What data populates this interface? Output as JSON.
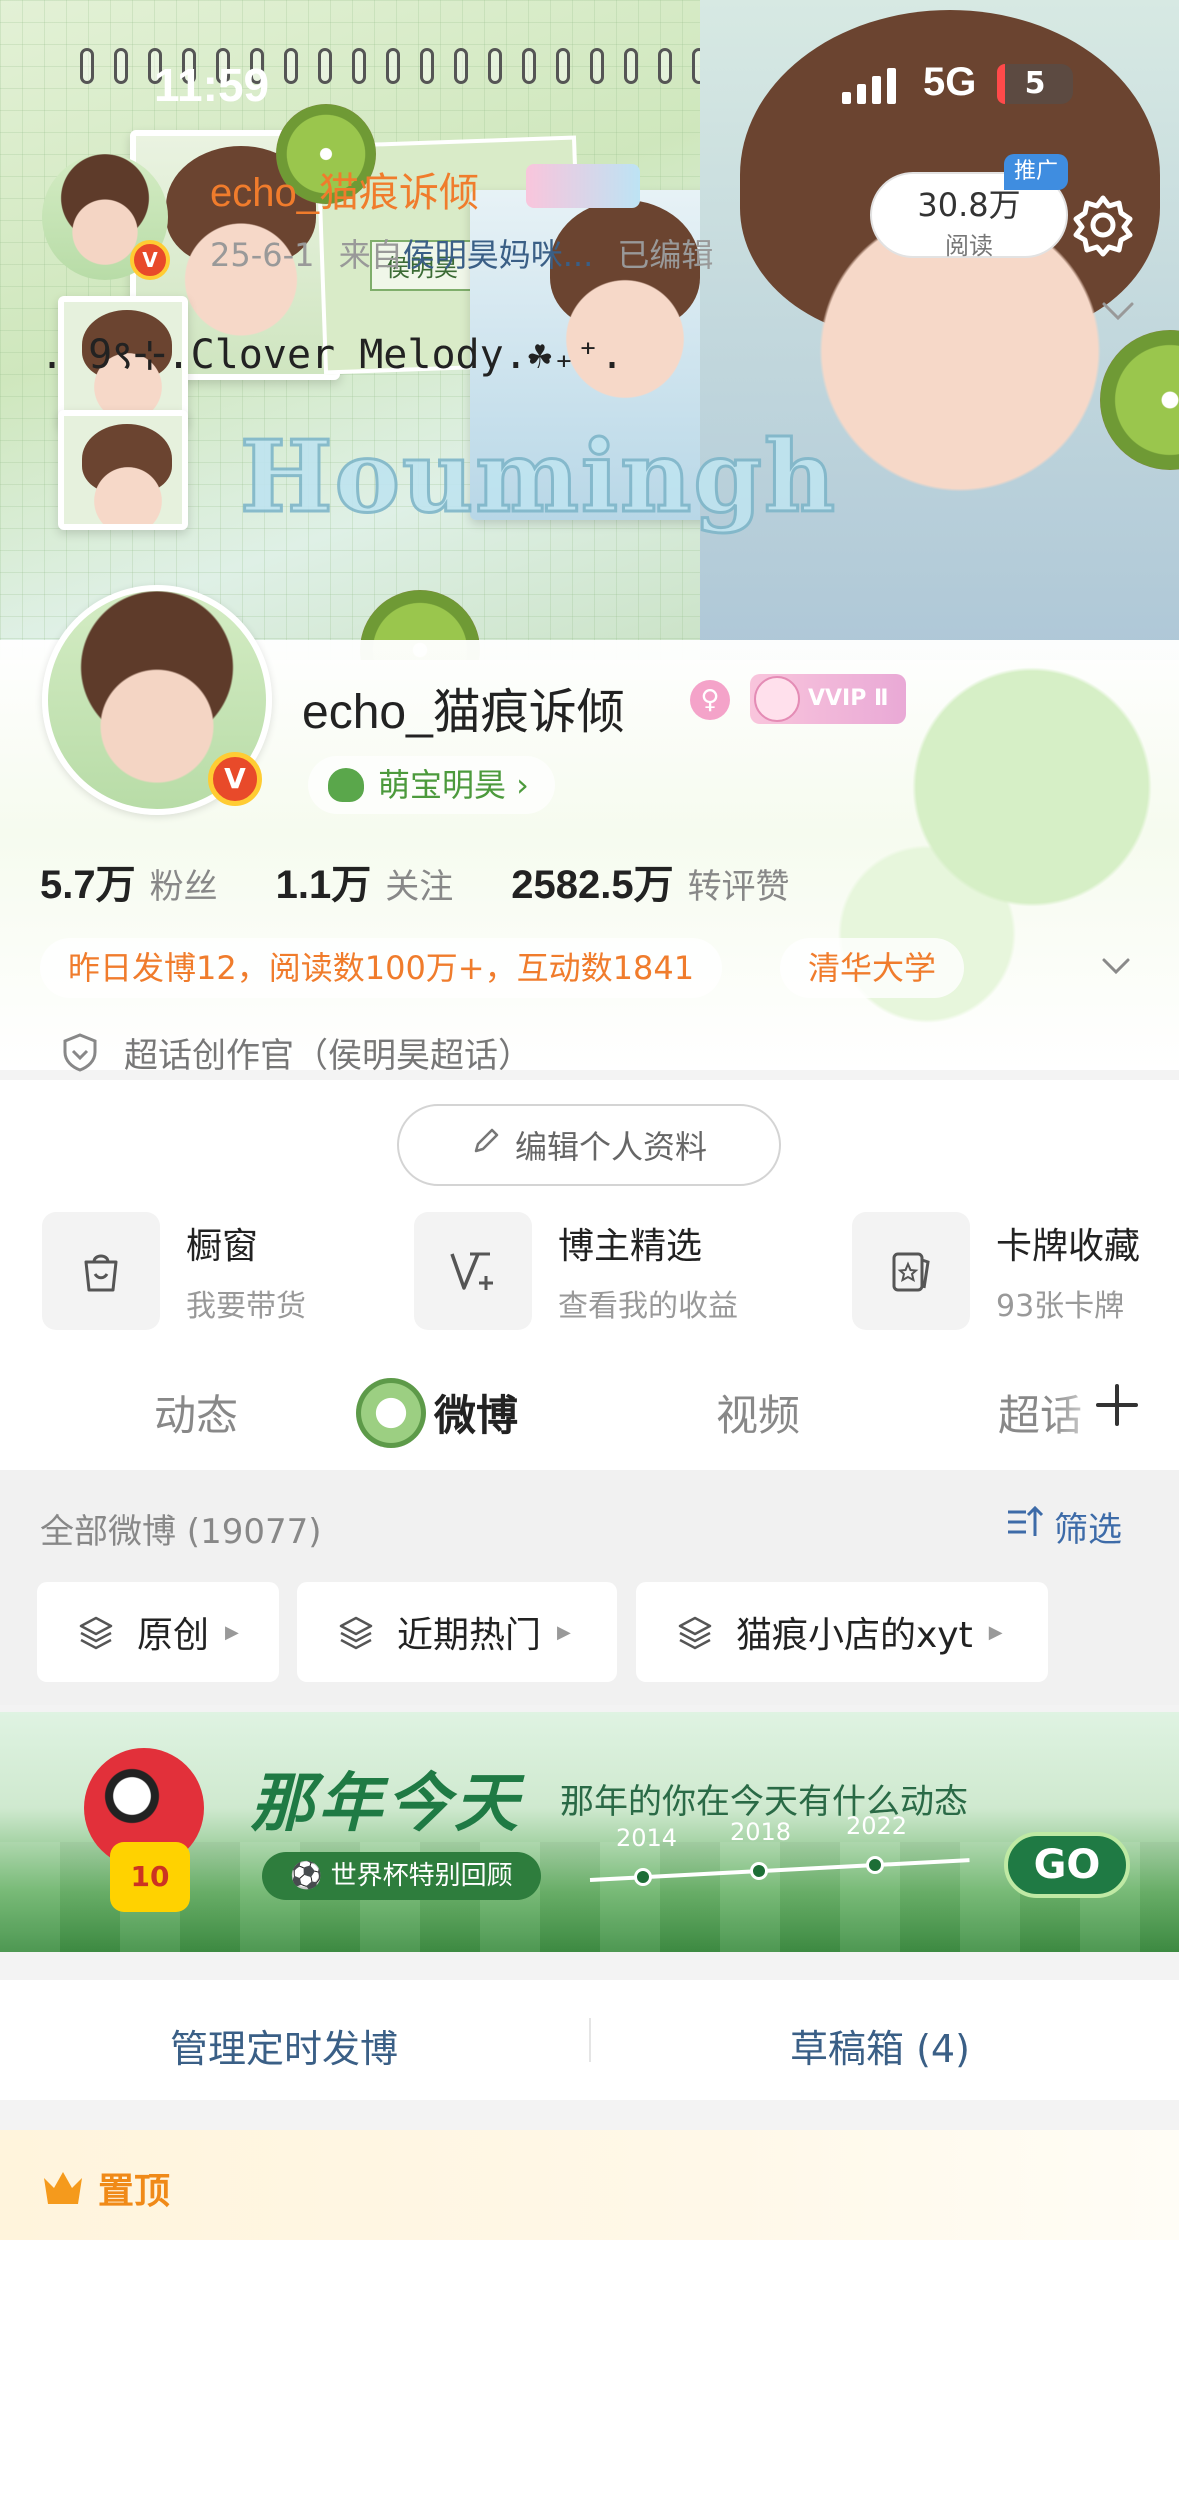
{
  "status_bar": {
    "time": "11:59",
    "network": "5G",
    "battery": "5"
  },
  "banner": {
    "text_houm": "Houmingh",
    "note_name": "侯明昊"
  },
  "profile": {
    "username": "echo_猫痕诉倾",
    "vip_badge": "VVIP Ⅱ",
    "fan_group": "萌宝明昊 ›",
    "stats": [
      {
        "value": "5.7万",
        "label": "粉丝"
      },
      {
        "value": "1.1万",
        "label": "关注"
      },
      {
        "value": "2582.5万",
        "label": "转评赞"
      }
    ],
    "activity": "昨日发博12，阅读数100万+，互动数1841",
    "school": "清华大学",
    "super_topic": "超话创作官（侯明昊超话）",
    "edit_button": "编辑个人资料"
  },
  "features": [
    {
      "title": "橱窗",
      "subtitle": "我要带货"
    },
    {
      "title": "博主精选",
      "subtitle": "查看我的收益"
    },
    {
      "title": "卡牌收藏",
      "subtitle": "93张卡牌"
    }
  ],
  "tabs": [
    {
      "label": "动态"
    },
    {
      "label": "微博"
    },
    {
      "label": "视频"
    },
    {
      "label": "超话"
    }
  ],
  "feed_filter": {
    "all_label": "全部微博 (19077)",
    "filter_label": "筛选",
    "chips": [
      {
        "label": "原创"
      },
      {
        "label": "近期热门"
      },
      {
        "label": "猫痕小店的xyt"
      }
    ]
  },
  "ad": {
    "title": "那年今天",
    "subtitle": "那年的你在今天有什么动态",
    "pill": "世界杯特别回顾",
    "years": [
      "2014",
      "2018",
      "2022"
    ],
    "go": "GO",
    "mascot_number": "10"
  },
  "manage": {
    "scheduled": "管理定时发博",
    "drafts": "草稿箱 (4)"
  },
  "pinned": {
    "label": "置顶",
    "name": "echo_猫痕诉倾",
    "date": "25-6-1",
    "from_prefix": "来自",
    "source": "侯明昊妈咪...",
    "edited": "已编辑",
    "read_count": "30.8万",
    "read_label": "阅读",
    "promo": "推广",
    "text": ". 9९⊹.Clover Melody.☘₊⁺."
  }
}
